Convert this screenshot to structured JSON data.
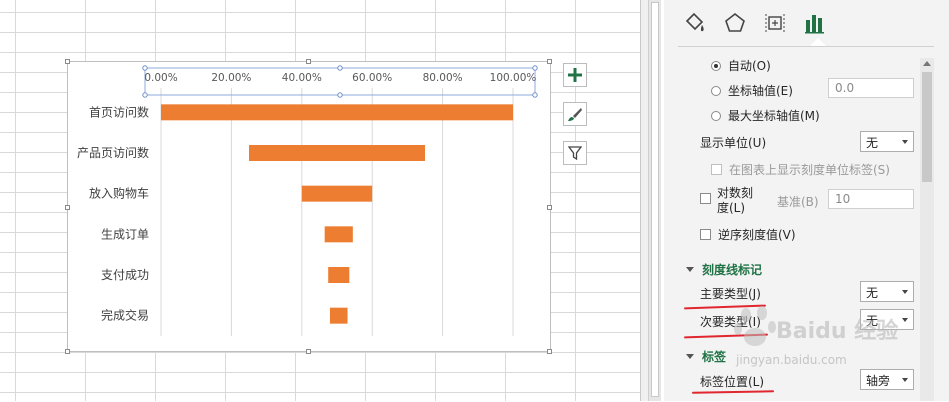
{
  "chart_data": {
    "type": "bar",
    "orientation": "horizontal",
    "floating": true,
    "categories": [
      "首页访问数",
      "产品页访问数",
      "放入购物车",
      "生成订单",
      "支付成功",
      "完成交易"
    ],
    "starts": [
      0,
      25,
      40,
      46.5,
      47.5,
      48
    ],
    "ends": [
      100,
      75,
      60,
      54.5,
      53.5,
      53
    ],
    "xtick_labels": [
      "0.00%",
      "20.00%",
      "40.00%",
      "60.00%",
      "80.00%",
      "100.00%"
    ],
    "xlim": [
      0,
      100
    ],
    "axis_position": "top",
    "bar_color": "#ED7D31",
    "grid": true
  },
  "chart_buttons": {
    "elements": "plus-icon",
    "styles": "brush-icon",
    "filters": "filter-icon"
  },
  "panel": {
    "tabs": [
      "fill-line-icon",
      "effects-icon",
      "size-properties-icon",
      "axis-options-icon"
    ],
    "opt_auto": "自动(O)",
    "opt_axis_value": "坐标轴值(E)",
    "axis_value_input": "0.0",
    "opt_max_axis": "最大坐标轴值(M)",
    "display_unit_label": "显示单位(U)",
    "display_unit_value": "无",
    "show_unit_label": "在图表上显示刻度单位标签(S)",
    "log_scale_line1": "对数刻",
    "log_scale_line2": "度(L)",
    "base_label": "基准(B)",
    "base_value": "10",
    "reverse_label": "逆序刻度值(V)",
    "section_tick": "刻度线标记",
    "major_type_label": "主要类型(J)",
    "major_type_value": "无",
    "minor_type_label": "次要类型(I)",
    "minor_type_value": "无",
    "section_labels": "标签",
    "label_pos_label": "标签位置(L)",
    "label_pos_value": "轴旁"
  },
  "watermark": {
    "line1": "Baidu 经验",
    "line2": "jingyan.baidu.com"
  },
  "colors": {
    "accent_green": "#217346",
    "underline_red": "#E0262E"
  }
}
